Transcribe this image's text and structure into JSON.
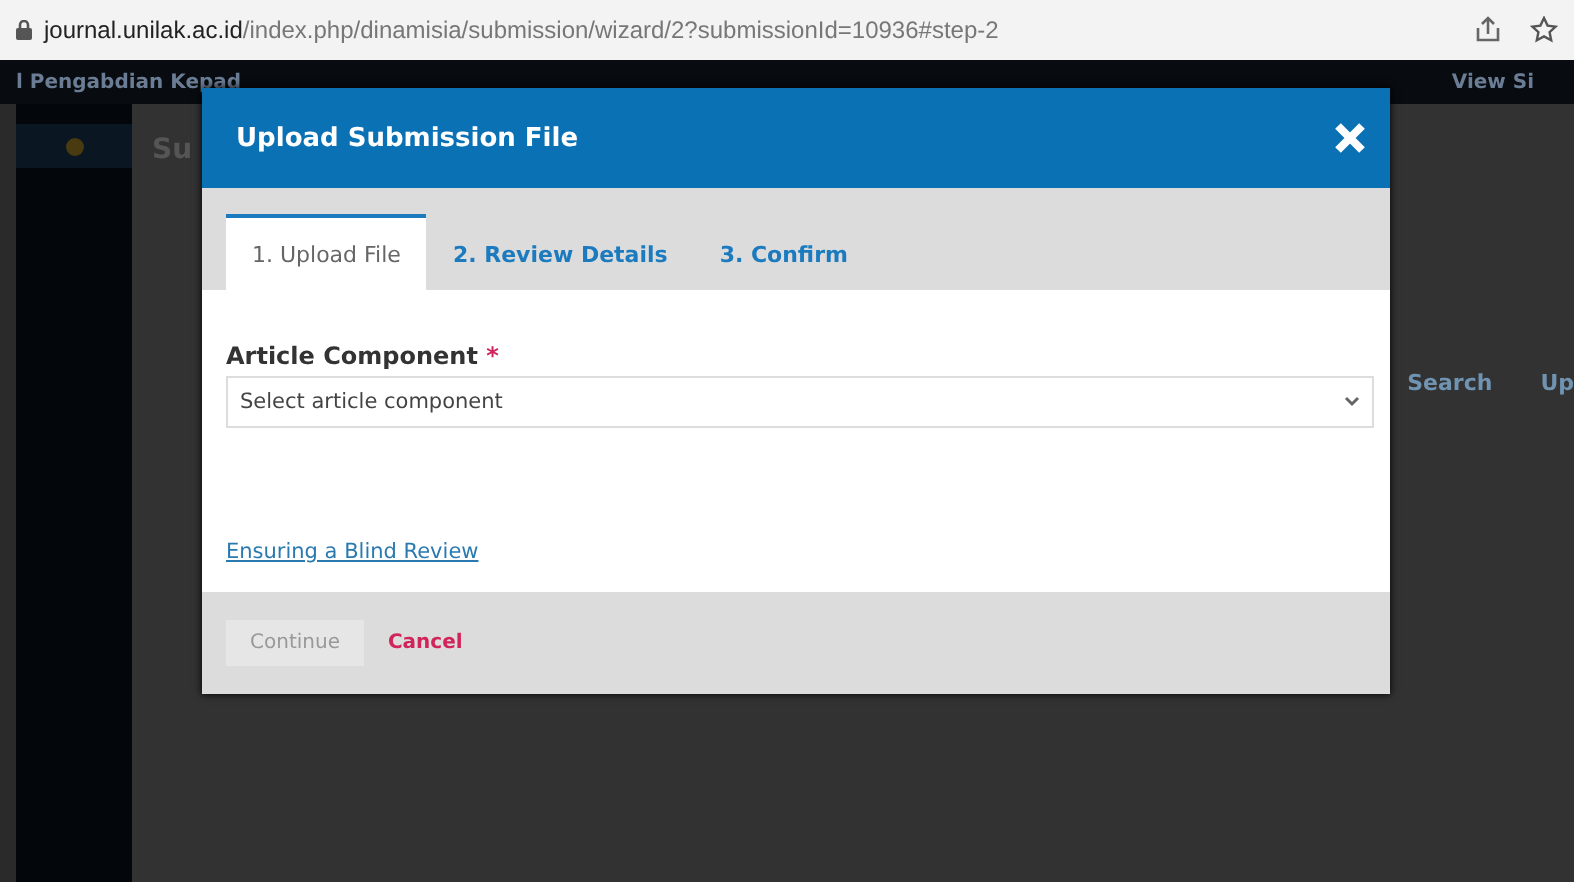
{
  "browser": {
    "url_host": "journal.unilak.ac.id",
    "url_path": "/index.php/dinamisia/submission/wizard/2?submissionId=10936#step-2"
  },
  "background": {
    "site_title": "l Pengabdian Kepad",
    "view_site": "View Si",
    "page_heading": "Su",
    "search": "Search",
    "upload": "Up"
  },
  "dialog": {
    "title": "Upload Submission File",
    "tabs": [
      {
        "label": "1. Upload File",
        "selected": true
      },
      {
        "label": "2. Review Details",
        "selected": false
      },
      {
        "label": "3. Confirm",
        "selected": false
      }
    ],
    "field": {
      "label": "Article Component",
      "required_mark": "*",
      "placeholder": "Select article component"
    },
    "link": "Ensuring a Blind Review",
    "buttons": [
      {
        "label": "Continue",
        "kind": "button",
        "disabled": true
      },
      {
        "label": "Cancel",
        "kind": "link",
        "disabled": false
      }
    ]
  }
}
